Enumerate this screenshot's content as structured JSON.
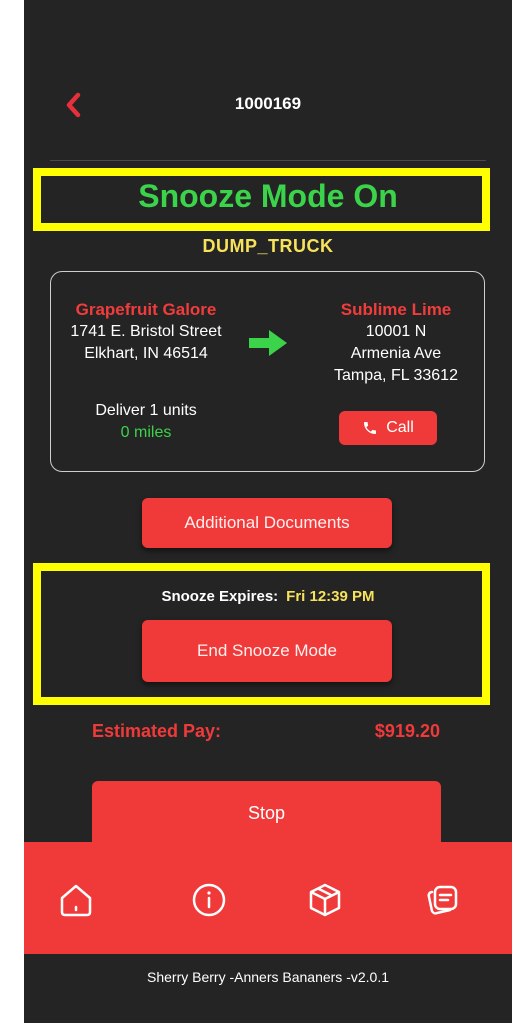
{
  "header": {
    "order_id": "1000169",
    "back_icon": "chevron-left-icon"
  },
  "status": {
    "title": "Snooze Mode On",
    "vehicle_type": "DUMP_TRUCK"
  },
  "route": {
    "pickup": {
      "name": "Grapefruit Galore",
      "address_line1": "1741 E. Bristol Street",
      "address_line2": "Elkhart, IN 46514"
    },
    "dropoff": {
      "name": "Sublime Lime",
      "address_line1": "10001 N",
      "address_line2": "Armenia Ave",
      "address_line3": "Tampa, FL 33612"
    },
    "deliver_text": "Deliver 1 units",
    "distance": "0 miles",
    "call_label": "Call"
  },
  "actions": {
    "documents_label": "Additional Documents",
    "end_snooze_label": "End Snooze Mode",
    "stop_label": "Stop"
  },
  "snooze": {
    "expires_label": "Snooze Expires:",
    "expires_time": "Fri 12:39 PM"
  },
  "pay": {
    "label": "Estimated Pay:",
    "value": "$919.20"
  },
  "tabbar": {
    "items": [
      "home-icon",
      "info-icon",
      "package-icon",
      "notes-icon"
    ]
  },
  "footer": {
    "text": "Sherry Berry  -Anners Bananers  -v2.0.1"
  },
  "colors": {
    "accent": "#f03a3a",
    "background": "#242424",
    "success": "#3bd34a",
    "highlight": "#f7e35b",
    "annotation": "#ffff00"
  }
}
